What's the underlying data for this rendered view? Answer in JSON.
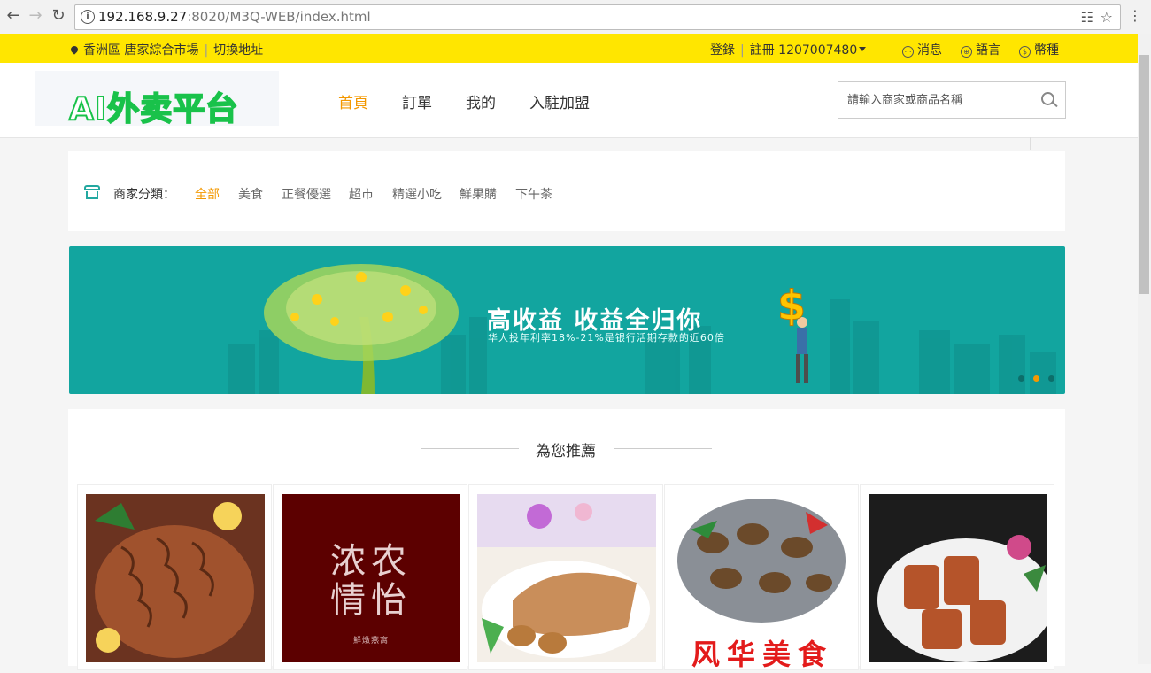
{
  "browser": {
    "url_host": "192.168.9.27",
    "url_rest": ":8020/M3Q-WEB/index.html"
  },
  "topbar": {
    "location": "香洲區 唐家綜合市場",
    "switch_address": "切換地址",
    "login": "登錄",
    "register": "註冊",
    "phone": "1207007480",
    "messages": "消息",
    "language": "語言",
    "currency": "幣種"
  },
  "header": {
    "logo_text": "AI外卖平台",
    "nav": [
      {
        "label": "首頁",
        "active": true
      },
      {
        "label": "訂單",
        "active": false
      },
      {
        "label": "我的",
        "active": false
      },
      {
        "label": "入駐加盟",
        "active": false
      }
    ],
    "search_placeholder": "請輸入商家或商品名稱"
  },
  "categories": {
    "label": "商家分類：",
    "items": [
      "全部",
      "美食",
      "正餐優選",
      "超市",
      "精選小吃",
      "鮮果購",
      "下午茶"
    ],
    "active_index": 0
  },
  "banner": {
    "title": "高收益 收益全归你",
    "subtitle": "华人投年利率18%-21%是银行活期存款的近60倍",
    "slides": 3,
    "active_slide": 1
  },
  "recommend": {
    "title": "為您推薦",
    "cards": [
      {
        "image": "braised-tripe"
      },
      {
        "image": "nongyi-brand-logo",
        "text": "浓农情怡",
        "subtext": "鮮燉燕窩"
      },
      {
        "image": "roast-duck-eggs"
      },
      {
        "image": "stir-fried-clams",
        "text": "风华美食"
      },
      {
        "image": "braised-pork-ribs"
      }
    ]
  },
  "colors": {
    "topbar": "#ffe600",
    "accent": "#f39800",
    "banner": "#12a59f",
    "logo": "#19c24a"
  }
}
